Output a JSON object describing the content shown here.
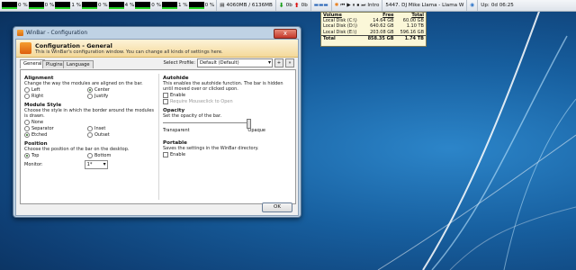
{
  "taskbar": {
    "cpu": [
      "0 %",
      "0 %",
      "1 %",
      "0 %",
      "4 %",
      "0 %",
      "1 %",
      "0 %"
    ],
    "memory": "4060MB / 6136MB",
    "down": "0b",
    "up": "0b",
    "media_title": "Intro",
    "now_playing": "5447. DJ Mike Llama - Llama W",
    "uptime_label": "Up:",
    "uptime": "0d 06:25"
  },
  "disks": {
    "headers": [
      "Volume",
      "Free",
      "Total"
    ],
    "rows": [
      [
        "Local Disk (C:\\)",
        "14.64 GB",
        "60.00 GB"
      ],
      [
        "Local Disk (D:\\)",
        "640.62 GB",
        "1.10 TB"
      ],
      [
        "Local Disk (E:\\)",
        "203.08 GB",
        "596.16 GB"
      ]
    ],
    "total": [
      "Total",
      "858.35 GB",
      "1.74 TB"
    ]
  },
  "window": {
    "title": "WinBar - Configuration",
    "close": "x",
    "header_title": "Configuration - General",
    "header_desc": "This is WinBar's configuration window. You can change all kinds of settings here.",
    "tabs": [
      "General",
      "Plugins",
      "Language"
    ],
    "profile_label": "Select Profile:",
    "profile_value": "Default (Default)",
    "profile_plus": "+",
    "profile_arrow": "»",
    "alignment": {
      "title": "Alignment",
      "desc": "Change the way the modules are aligned on the bar.",
      "options": [
        "Left",
        "Center",
        "Right",
        "Justify"
      ]
    },
    "module_style": {
      "title": "Module Style",
      "desc": "Choose the style in which the border around the modules is drawn.",
      "options": [
        "None",
        "Separator",
        "Inset",
        "Etched",
        "Outset"
      ]
    },
    "position": {
      "title": "Position",
      "desc": "Choose the position of the bar on the desktop.",
      "options": [
        "Top",
        "Bottom"
      ],
      "monitor_label": "Monitor:",
      "monitor_value": "1*"
    },
    "autohide": {
      "title": "Autohide",
      "desc": "This enables the autohide function. The bar is hidden until moved over or clicked upon.",
      "enable": "Enable",
      "mouseclick": "Require Mouseclick to Open"
    },
    "opacity": {
      "title": "Opacity",
      "desc": "Set the opacity of the bar.",
      "min_label": "Transparent",
      "max_label": "Opaque",
      "value_fraction": 1.0
    },
    "portable": {
      "title": "Portable",
      "desc": "Saves the settings in the WinBar directory.",
      "enable": "Enable"
    },
    "ok": "OK"
  },
  "colors": {
    "accent": "#f39c2f",
    "window_frame": "#bfd2e4",
    "desktop": "#175f9f"
  }
}
